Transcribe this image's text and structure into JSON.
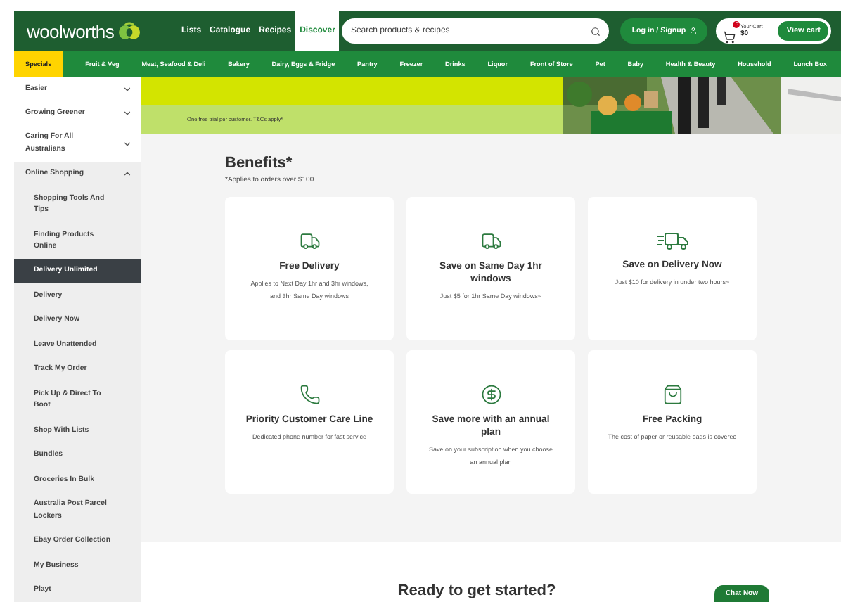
{
  "header": {
    "logo": "woolworths",
    "links": [
      {
        "label": "Lists",
        "selected": false
      },
      {
        "label": "Catalogue",
        "selected": false
      },
      {
        "label": "Recipes",
        "selected": false
      },
      {
        "label": "Discover",
        "selected": true
      }
    ],
    "search": {
      "placeholder": "Search products & recipes"
    },
    "login": "Log in / Signup",
    "cart": {
      "badge": "0",
      "label": "Your Cart",
      "total": "$0",
      "button": "View cart"
    }
  },
  "categories": [
    {
      "label": "Specials",
      "selected": true
    },
    {
      "label": "Fruit & Veg",
      "selected": false
    },
    {
      "label": "Meat, Seafood & Deli",
      "selected": false
    },
    {
      "label": "Bakery",
      "selected": false
    },
    {
      "label": "Dairy, Eggs & Fridge",
      "selected": false
    },
    {
      "label": "Pantry",
      "selected": false
    },
    {
      "label": "Freezer",
      "selected": false
    },
    {
      "label": "Drinks",
      "selected": false
    },
    {
      "label": "Liquor",
      "selected": false
    },
    {
      "label": "Front of Store",
      "selected": false
    },
    {
      "label": "Pet",
      "selected": false
    },
    {
      "label": "Baby",
      "selected": false
    },
    {
      "label": "Health & Beauty",
      "selected": false
    },
    {
      "label": "Household",
      "selected": false
    },
    {
      "label": "Lunch Box",
      "selected": false
    }
  ],
  "sidebar": {
    "items": [
      {
        "label": "Easier",
        "expanded": false
      },
      {
        "label": "Growing Greener",
        "expanded": false
      },
      {
        "label": "Caring For All Australians",
        "expanded": false
      },
      {
        "label": "Online Shopping",
        "expanded": true,
        "children": [
          {
            "label": "Shopping Tools And Tips",
            "selected": false
          },
          {
            "label": "Finding Products Online",
            "selected": false
          },
          {
            "label": "Delivery Unlimited",
            "selected": true
          },
          {
            "label": "Delivery",
            "selected": false
          },
          {
            "label": "Delivery Now",
            "selected": false
          },
          {
            "label": "Leave Unattended",
            "selected": false
          },
          {
            "label": "Track My Order",
            "selected": false
          },
          {
            "label": "Pick Up & Direct To Boot",
            "selected": false
          },
          {
            "label": "Shop With Lists",
            "selected": false
          },
          {
            "label": "Bundles",
            "selected": false
          },
          {
            "label": "Groceries In Bulk",
            "selected": false
          },
          {
            "label": "Australia Post Parcel Lockers",
            "selected": false
          },
          {
            "label": "Ebay Order Collection",
            "selected": false
          },
          {
            "label": "My Business",
            "selected": false
          },
          {
            "label": "Playt",
            "selected": false
          }
        ]
      }
    ]
  },
  "banner": {
    "note": "One free trial per customer. T&Cs apply*"
  },
  "benefits": {
    "title": "Benefits*",
    "subtitle": "*Applies to orders over $100",
    "cards": [
      {
        "title": "Free Delivery",
        "text": "Applies to Next Day 1hr and 3hr windows, and 3hr Same Day windows"
      },
      {
        "title": "Save on Same Day 1hr windows",
        "text": "Just $5 for 1hr Same Day windows~"
      },
      {
        "title": "Save on Delivery Now",
        "text": "Just $10 for delivery in under two hours~"
      },
      {
        "title": "Priority Customer Care Line",
        "text": "Dedicated phone number for fast service"
      },
      {
        "title": "Save more with an annual plan",
        "text": "Save on your subscription when you choose an annual plan"
      },
      {
        "title": "Free Packing",
        "text": "The cost of paper or reusable bags is covered"
      }
    ]
  },
  "cta": {
    "title": "Ready to get started?",
    "chat": "Chat Now"
  }
}
